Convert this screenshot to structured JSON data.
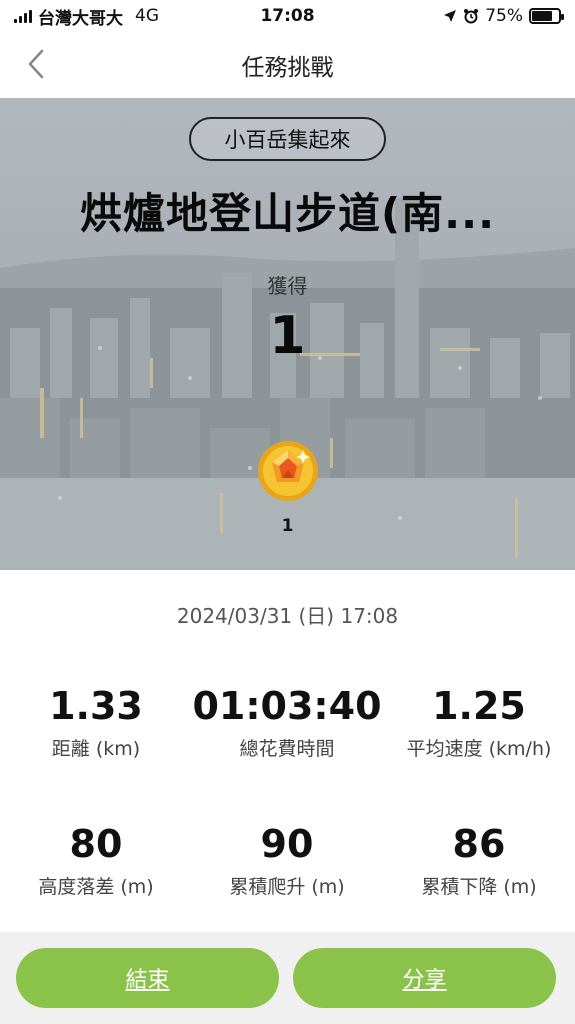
{
  "status_bar": {
    "carrier": "台灣大哥大",
    "network": "4G",
    "time": "17:08",
    "battery": "75%",
    "battery_level": 0.75
  },
  "nav": {
    "title": "任務挑戰"
  },
  "hero": {
    "category": "小百岳集起來",
    "title": "烘爐地登山步道(南...",
    "obtained_label": "獲得",
    "obtained_count": "1",
    "medal_count": "1"
  },
  "record": {
    "datetime": "2024/03/31 (日) 17:08",
    "stats": [
      {
        "value": "1.33",
        "label": "距離 (km)"
      },
      {
        "value": "01:03:40",
        "label": "總花費時間"
      },
      {
        "value": "1.25",
        "label": "平均速度 (km/h)"
      },
      {
        "value": "80",
        "label": "高度落差 (m)"
      },
      {
        "value": "90",
        "label": "累積爬升 (m)"
      },
      {
        "value": "86",
        "label": "累積下降 (m)"
      }
    ]
  },
  "actions": {
    "end_label": "結束",
    "share_label": "分享",
    "accent_color": "#8bc34a"
  }
}
